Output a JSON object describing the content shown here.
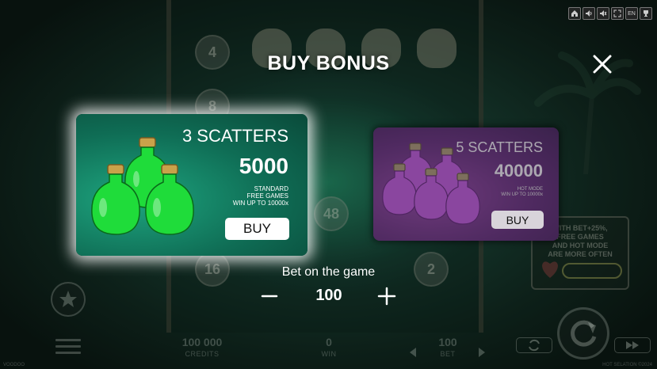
{
  "modal": {
    "title": "BUY BONUS",
    "bet_label": "Bet on the game",
    "bet_value": "100"
  },
  "options": [
    {
      "scatters": "3 SCATTERS",
      "price": "5000",
      "desc_line1": "STANDARD",
      "desc_line2": "FREE GAMES",
      "desc_line3": "WIN UP TO 10000x",
      "buy_label": "BUY",
      "state": "selected",
      "bottle_color": "#1fdc3a"
    },
    {
      "scatters": "5 SCATTERS",
      "price": "40000",
      "desc_line1": "HOT MODE",
      "desc_line2": "WIN UP TO 10000x",
      "buy_label": "BUY",
      "state": "unselected",
      "bottle_color": "#b44ccf"
    }
  ],
  "background": {
    "reel_numbers": [
      "4",
      "8",
      "48",
      "16",
      "2"
    ],
    "side_box_line1": "WITH BET+25%,",
    "side_box_line2": "FREE GAMES",
    "side_box_line3": "AND HOT MODE",
    "side_box_line4": "ARE MORE OFTEN"
  },
  "hud": {
    "credits_value": "100 000",
    "credits_label": "CREDITS",
    "win_value": "0",
    "win_label": "WIN",
    "bet_value": "100",
    "bet_label": "BET",
    "footer_left": "VOODOO",
    "footer_right": "HOT SELATION ©2024"
  },
  "toolbar": {
    "buttons": [
      "home-icon",
      "volume-icon",
      "mute-icon",
      "fullscreen-icon",
      "EN",
      "trophy-icon"
    ],
    "language": "EN"
  },
  "colors": {
    "green_card": "#0f6d55",
    "purple_card": "#5a2170",
    "glow": "#ffffff"
  }
}
